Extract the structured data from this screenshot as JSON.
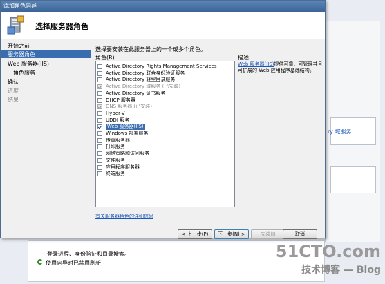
{
  "background": {
    "right_link": "ry 域服务",
    "bottom_line1": "登录进程、身份验证和目录搜索。",
    "bottom_line2": "使用向导时已禁用刷新"
  },
  "watermark": {
    "line1": "51CTO.com",
    "line2": "技术博客 — Blog"
  },
  "wizard": {
    "window_title": "添加角色向导",
    "page_title": "选择服务器角色",
    "nav": [
      {
        "label": "开始之前",
        "state": "normal",
        "sub": false
      },
      {
        "label": "服务器角色",
        "state": "selected",
        "sub": false
      },
      {
        "label": "Web 服务器(IIS)",
        "state": "normal",
        "sub": false
      },
      {
        "label": "角色服务",
        "state": "normal",
        "sub": true
      },
      {
        "label": "确认",
        "state": "normal",
        "sub": false
      },
      {
        "label": "进度",
        "state": "disabled",
        "sub": false
      },
      {
        "label": "结果",
        "state": "disabled",
        "sub": false
      }
    ],
    "instruction": "选择要安装在此服务器上的一个或多个角色。",
    "roles_label": "角色(R):",
    "roles": [
      {
        "label": "Active Directory Rights Management Services",
        "checked": false,
        "disabled": false,
        "highlight": false
      },
      {
        "label": "Active Directory 联合身份验证服务",
        "checked": false,
        "disabled": false,
        "highlight": false
      },
      {
        "label": "Active Directory 轻型目录服务",
        "checked": false,
        "disabled": false,
        "highlight": false
      },
      {
        "label": "Active Directory 域服务  (已安装)",
        "checked": true,
        "disabled": true,
        "highlight": false
      },
      {
        "label": "Active Directory 证书服务",
        "checked": false,
        "disabled": false,
        "highlight": false
      },
      {
        "label": "DHCP 服务器",
        "checked": false,
        "disabled": false,
        "highlight": false
      },
      {
        "label": "DNS 服务器  (已安装)",
        "checked": true,
        "disabled": true,
        "highlight": false
      },
      {
        "label": "Hyper-V",
        "checked": false,
        "disabled": false,
        "highlight": false
      },
      {
        "label": "UDDI 服务",
        "checked": false,
        "disabled": false,
        "highlight": false
      },
      {
        "label": "Web 服务器(IIS)",
        "checked": true,
        "disabled": false,
        "highlight": true
      },
      {
        "label": "Windows 部署服务",
        "checked": false,
        "disabled": false,
        "highlight": false
      },
      {
        "label": "传真服务器",
        "checked": false,
        "disabled": false,
        "highlight": false
      },
      {
        "label": "打印服务",
        "checked": false,
        "disabled": false,
        "highlight": false
      },
      {
        "label": "网络策略和访问服务",
        "checked": false,
        "disabled": false,
        "highlight": false
      },
      {
        "label": "文件服务",
        "checked": false,
        "disabled": false,
        "highlight": false
      },
      {
        "label": "应用程序服务器",
        "checked": false,
        "disabled": false,
        "highlight": false
      },
      {
        "label": "终端服务",
        "checked": false,
        "disabled": false,
        "highlight": false
      }
    ],
    "description_title": "描述:",
    "description_link": "Web 服务器(IIS)",
    "description_text": "提供可靠、可管理并且可扩展的 Web 应用程序基础结构。",
    "more_info_link": "有关服务器角色的详细信息",
    "buttons": {
      "back": "< 上一步(P)",
      "next": "下一步(N) >",
      "install": "安装(I)",
      "cancel": "取消"
    }
  }
}
